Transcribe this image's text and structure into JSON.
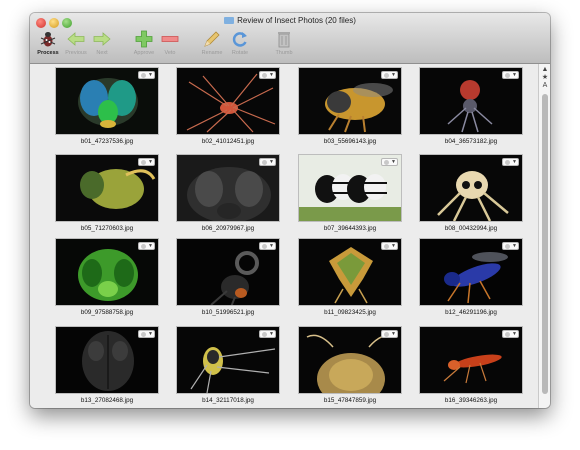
{
  "window": {
    "title": "Review of Insect Photos (20 files)"
  },
  "toolbar": {
    "buttons": [
      {
        "label": "Process",
        "icon": "process-icon",
        "enabled": true
      },
      {
        "label": "Previous",
        "icon": "arrow-left-icon",
        "enabled": false
      },
      {
        "label": "Next",
        "icon": "arrow-right-icon",
        "enabled": false
      },
      {
        "label": "Approve",
        "icon": "plus-icon",
        "enabled": false
      },
      {
        "label": "Veto",
        "icon": "minus-icon",
        "enabled": false
      },
      {
        "label": "Rename",
        "icon": "pencil-icon",
        "enabled": false
      },
      {
        "label": "Rotate",
        "icon": "rotate-icon",
        "enabled": false
      },
      {
        "label": "Thumb",
        "icon": "trash-icon",
        "enabled": false
      }
    ]
  },
  "sidebar_sizes": [
    "▲",
    "★",
    "A"
  ],
  "photos": [
    {
      "name": "b01_47237536.jpg"
    },
    {
      "name": "b02_41012451.jpg"
    },
    {
      "name": "b03_55696143.jpg"
    },
    {
      "name": "b04_36573182.jpg"
    },
    {
      "name": "b05_71270603.jpg"
    },
    {
      "name": "b06_20979967.jpg"
    },
    {
      "name": "b07_39644393.jpg"
    },
    {
      "name": "b08_00432994.jpg"
    },
    {
      "name": "b09_97588758.jpg"
    },
    {
      "name": "b10_51996521.jpg"
    },
    {
      "name": "b11_09823425.jpg"
    },
    {
      "name": "b12_46291196.jpg"
    },
    {
      "name": "b13_27082468.jpg"
    },
    {
      "name": "b14_32117018.jpg"
    },
    {
      "name": "b15_47847859.jpg"
    },
    {
      "name": "b16_39346263.jpg"
    }
  ],
  "colors": {
    "approve": "#43b02a",
    "veto": "#e35a5a",
    "rotate": "#3e82d1",
    "arrows": "#a9d86a"
  }
}
